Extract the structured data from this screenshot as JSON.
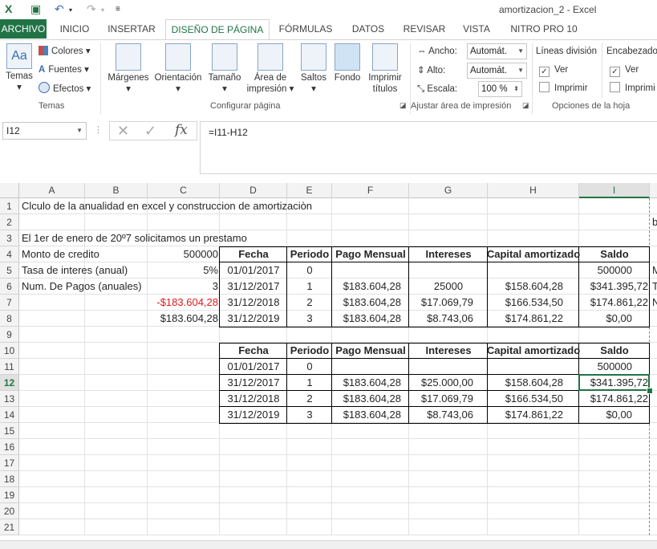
{
  "titlebar": {
    "title": "amortizacion_2 - Excel"
  },
  "tabs": [
    "ARCHIVO",
    "INICIO",
    "INSERTAR",
    "DISEÑO DE PÁGINA",
    "FÓRMULAS",
    "DATOS",
    "REVISAR",
    "VISTA",
    "NITRO PRO 10"
  ],
  "ribbon": {
    "temas": {
      "label": "Temas",
      "colores": "Colores",
      "fuentes": "Fuentes",
      "efectos": "Efectos",
      "group": "Temas"
    },
    "config": {
      "margenes": "Márgenes",
      "orientacion": "Orientación",
      "tamano": "Tamaño",
      "area1": "Área de",
      "area2": "impresión",
      "saltos": "Saltos",
      "fondo": "Fondo",
      "imprimir1": "Imprimir",
      "imprimir2": "títulos",
      "group": "Configurar página"
    },
    "ajustar": {
      "ancho": "Ancho:",
      "ancho_val": "Automát.",
      "alto": "Alto:",
      "alto_val": "Automát.",
      "escala": "Escala:",
      "escala_val": "100 %",
      "group": "Ajustar área de impresión"
    },
    "opciones": {
      "lineas": "Líneas división",
      "encabezado": "Encabezado",
      "ver1": "Ver",
      "imprimir1": "Imprimir",
      "ver2": "Ver",
      "imprimir2": "Imprimi",
      "group": "Opciones de la hoja"
    }
  },
  "formula_bar": {
    "namebox": "I12",
    "formula": "=I11-H12"
  },
  "columns": [
    "A",
    "B",
    "C",
    "D",
    "E",
    "F",
    "G",
    "H",
    "I"
  ],
  "rows": [
    "1",
    "2",
    "3",
    "4",
    "5",
    "6",
    "7",
    "8",
    "9",
    "10",
    "11",
    "12",
    "13",
    "14",
    "15",
    "16",
    "17",
    "18",
    "19",
    "20",
    "21"
  ],
  "cells": {
    "a1": "Clculo de la anualidad en excel y construccion de amortizaciòn",
    "a3": "El 1er de enero de 20º7 solicitamos un prestamo",
    "a4": "Monto de credito",
    "c4": "500000",
    "a5": "Tasa de interes (anual)",
    "c5": "5%",
    "a6": "Num. De Pagos (anuales)",
    "c6": "3",
    "c7": "-$183.604,28",
    "c8": "$183.604,28",
    "j2": "b",
    "j5": "M",
    "j6": "T",
    "j7": "N"
  },
  "table1": {
    "headers": [
      "Fecha",
      "Periodo",
      "Pago Mensual",
      "Intereses",
      "Capital amortizado",
      "Saldo"
    ],
    "rows": [
      [
        "01/01/2017",
        "0",
        "",
        "",
        "",
        "500000"
      ],
      [
        "31/12/2017",
        "1",
        "$183.604,28",
        "25000",
        "$158.604,28",
        "$341.395,72"
      ],
      [
        "31/12/2018",
        "2",
        "$183.604,28",
        "$17.069,79",
        "$166.534,50",
        "$174.861,22"
      ],
      [
        "31/12/2019",
        "3",
        "$183.604,28",
        "$8.743,06",
        "$174.861,22",
        "$0,00"
      ]
    ]
  },
  "table2": {
    "headers": [
      "Fecha",
      "Periodo",
      "Pago Mensual",
      "Intereses",
      "Capital amortizado",
      "Saldo"
    ],
    "rows": [
      [
        "01/01/2017",
        "0",
        "",
        "",
        "",
        "500000"
      ],
      [
        "31/12/2017",
        "1",
        "$183.604,28",
        "$25.000,00",
        "$158.604,28",
        "$341.395,72"
      ],
      [
        "31/12/2018",
        "2",
        "$183.604,28",
        "$17.069,79",
        "$166.534,50",
        "$174.861,22"
      ],
      [
        "31/12/2019",
        "3",
        "$183.604,28",
        "$8.743,06",
        "$174.861,22",
        "$0,00"
      ]
    ]
  },
  "colors": {
    "accent": "#217346",
    "negative": "#e0191b"
  }
}
